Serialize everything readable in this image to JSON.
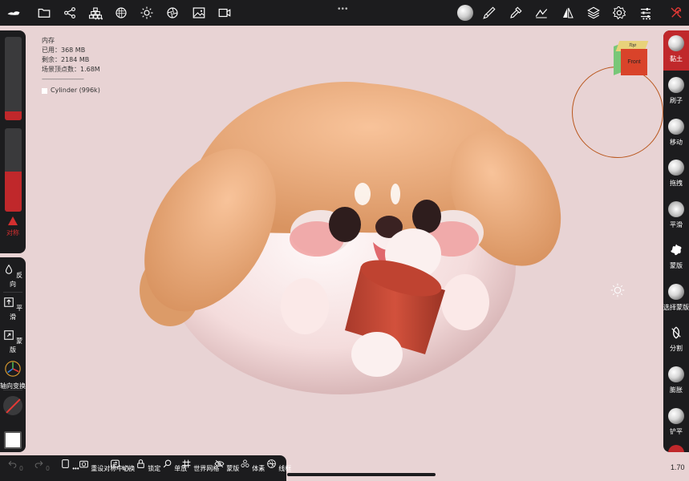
{
  "stats": {
    "title": "内存",
    "used": "已用：368 MB",
    "remaining": "剩余：2184 MB",
    "vertices": "场景顶点数：1.68M",
    "separator": "----------------------------------",
    "object": "Cylinder (996k)"
  },
  "top_dots": "•••",
  "left_panel": {
    "symmetry_label": "对称",
    "items": [
      {
        "label": "反向",
        "icon": "drop-icon"
      },
      {
        "label": "平滑",
        "icon": "upload-square-icon"
      },
      {
        "label": "蒙版",
        "icon": "mask-square-icon"
      },
      {
        "label": "轴向变换",
        "icon": "gizmo-axis-icon"
      }
    ],
    "radius_fill": 0.11,
    "intensity_fill": 0.48
  },
  "right_tools": [
    {
      "label": "黏土",
      "active": true
    },
    {
      "label": "刷子",
      "active": false
    },
    {
      "label": "移动",
      "active": false
    },
    {
      "label": "拖拽",
      "active": false
    },
    {
      "label": "平滑",
      "active": false
    },
    {
      "label": "蒙版",
      "active": false
    },
    {
      "label": "选择蒙版",
      "active": false
    },
    {
      "label": "分割",
      "active": false
    },
    {
      "label": "膨胀",
      "active": false
    },
    {
      "label": "铲平",
      "active": false
    }
  ],
  "bottom_bar": {
    "undo_count": "0",
    "redo_count": "0",
    "items": [
      {
        "label": "重设对称中心"
      },
      {
        "label": "切换"
      },
      {
        "label": "锁定"
      },
      {
        "label": "单放"
      },
      {
        "label": "世界网格"
      },
      {
        "label": "蒙版"
      },
      {
        "label": "体素"
      },
      {
        "label": "线框"
      }
    ]
  },
  "view_cube": {
    "front": "Front",
    "top": "Top"
  },
  "zoom": "1.70",
  "colors": {
    "accent": "#c0282b",
    "panel": "#1c1c1e",
    "background": "#e8d3d4",
    "ring": "#b9561c"
  }
}
